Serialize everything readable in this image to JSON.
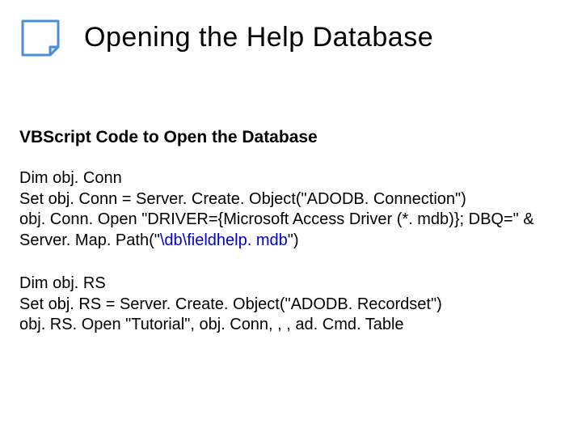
{
  "header": {
    "title": "Opening the Help Database",
    "icon": "note-icon"
  },
  "subtitle": "VBScript Code to Open the Database",
  "code1": {
    "l1": "Dim obj. Conn",
    "l2": "Set obj. Conn = Server. Create. Object(\"ADODB. Connection\")",
    "l3": "obj. Conn. Open \"DRIVER={Microsoft Access Driver (*. mdb)}; DBQ=\" & Server. Map. Path(\"",
    "l3_blue": "\\db\\fieldhelp. mdb",
    "l3_end": "\")"
  },
  "code2": {
    "l1": "Dim obj. RS",
    "l2": "Set obj. RS = Server. Create. Object(\"ADODB. Recordset\")",
    "l3": "obj. RS. Open \"Tutorial\", obj. Conn, , , ad. Cmd. Table"
  }
}
